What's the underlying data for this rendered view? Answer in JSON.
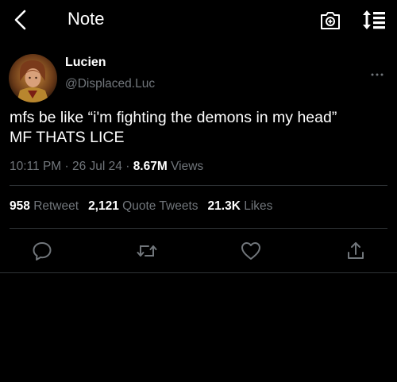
{
  "header": {
    "title": "Note",
    "back_icon": "chevron-left-icon",
    "camera_icon": "camera-add-icon",
    "sort_icon": "sort-list-icon"
  },
  "author": {
    "name": "Lucien",
    "handle": "@Displaced.Luc"
  },
  "tweet": {
    "line1": "mfs be like “i'm fighting the demons in my head”",
    "line2": "MF THATS LICE"
  },
  "meta": {
    "time": "10:11 PM",
    "sep1": " · ",
    "date": "26 Jul 24",
    "sep2": " · ",
    "views_count": "8.67M",
    "views_label": " Views"
  },
  "stats": {
    "retweets_count": "958",
    "retweets_label": "Retweet",
    "quotes_count": "2,121",
    "quotes_label": "Quote Tweets",
    "likes_count": "21.3K",
    "likes_label": "Likes"
  },
  "actions": [
    "reply-icon",
    "retweet-icon",
    "like-icon",
    "share-icon"
  ],
  "colors": {
    "background": "#000000",
    "text": "#ffffff",
    "secondary": "#71767b",
    "divider": "#2f3336"
  }
}
